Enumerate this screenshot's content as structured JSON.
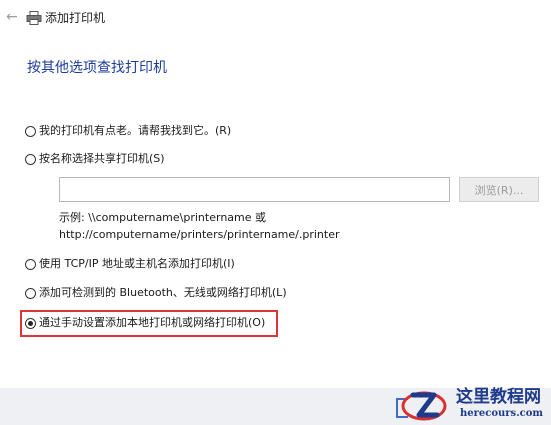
{
  "window": {
    "title": "添加打印机"
  },
  "heading": "按其他选项查找打印机",
  "options": [
    {
      "label": "我的打印机有点老。请帮我找到它。(R)",
      "selected": false
    },
    {
      "label": "按名称选择共享打印机(S)",
      "selected": false
    },
    {
      "label": "使用 TCP/IP 地址或主机名添加打印机(I)",
      "selected": false
    },
    {
      "label": "添加可检测到的 Bluetooth、无线或网络打印机(L)",
      "selected": false
    },
    {
      "label": "通过手动设置添加本地打印机或网络打印机(O)",
      "selected": true
    }
  ],
  "share_input": {
    "value": "",
    "placeholder": ""
  },
  "browse_label": "浏览(R)...",
  "example": {
    "line1": "示例: \\\\computername\\printername 或",
    "line2": "http://computername/printers/printername/.printer"
  },
  "watermark": {
    "name": "这里教程网",
    "site": "herecours.com"
  },
  "colors": {
    "heading": "#1e3c9e",
    "highlight": "#e03434",
    "watermark": "#1e3a8a"
  }
}
